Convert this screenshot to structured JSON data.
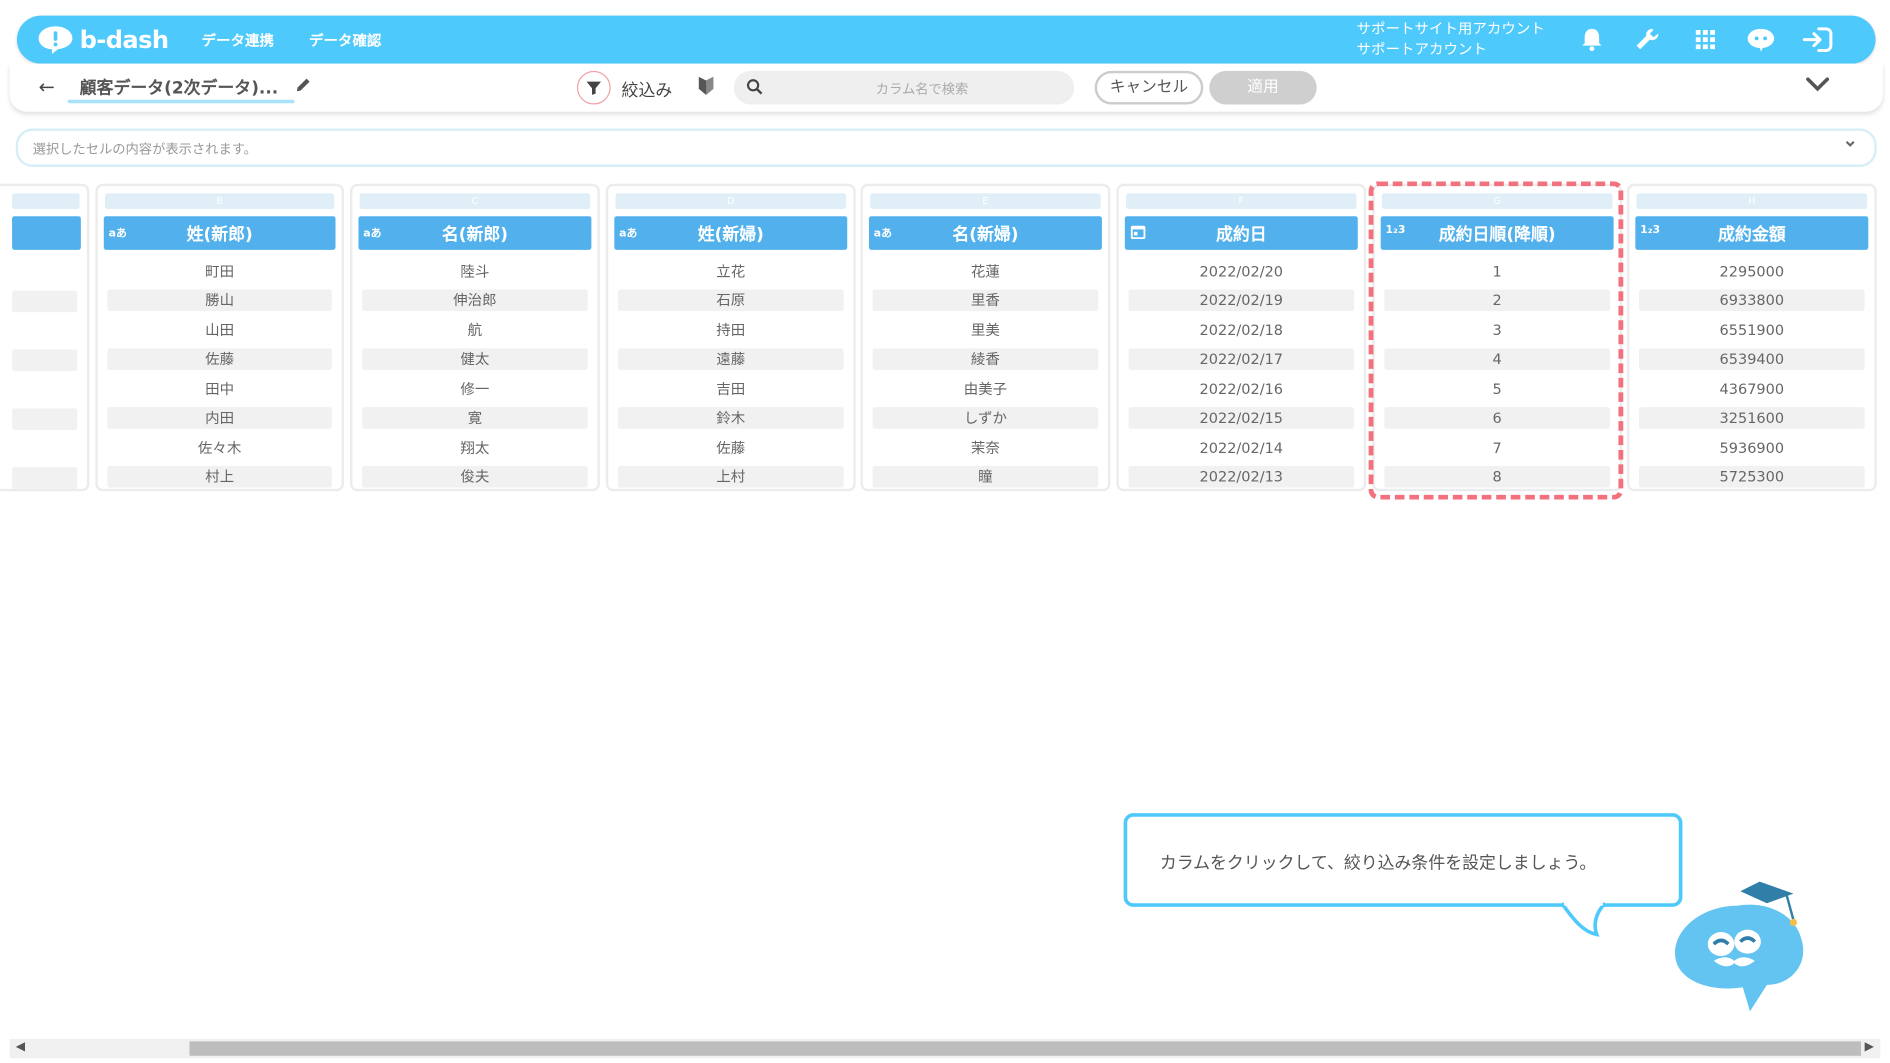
{
  "app": {
    "logo_text": "b-dash"
  },
  "nav": {
    "item1": "データ連携",
    "item2": "データ確認"
  },
  "account": {
    "line1": "サポートサイト用アカウント",
    "line2": "サポートアカウント"
  },
  "toolbar": {
    "breadcrumb": "顧客データ(2次データ)...",
    "filter_label": "絞込み",
    "search_placeholder": "カラム名で検索",
    "cancel_label": "キャンセル",
    "apply_label": "適用"
  },
  "cell_display": {
    "placeholder": "選択したセルの内容が表示されます。"
  },
  "columns": [
    {
      "letter": "B",
      "type": "aあ",
      "name": "姓(新郎)",
      "values": [
        "町田",
        "勝山",
        "山田",
        "佐藤",
        "田中",
        "内田",
        "佐々木",
        "村上"
      ]
    },
    {
      "letter": "C",
      "type": "aあ",
      "name": "名(新郎)",
      "values": [
        "陸斗",
        "伸治郎",
        "航",
        "健太",
        "修一",
        "寛",
        "翔太",
        "俊夫"
      ]
    },
    {
      "letter": "D",
      "type": "aあ",
      "name": "姓(新婦)",
      "values": [
        "立花",
        "石原",
        "持田",
        "遠藤",
        "吉田",
        "鈴木",
        "佐藤",
        "上村"
      ]
    },
    {
      "letter": "E",
      "type": "aあ",
      "name": "名(新婦)",
      "values": [
        "花蓮",
        "里香",
        "里美",
        "綾香",
        "由美子",
        "しずか",
        "茉奈",
        "瞳"
      ]
    },
    {
      "letter": "F",
      "type": "",
      "name": "成約日",
      "values": [
        "2022/02/20",
        "2022/02/19",
        "2022/02/18",
        "2022/02/17",
        "2022/02/16",
        "2022/02/15",
        "2022/02/14",
        "2022/02/13"
      ]
    },
    {
      "letter": "G",
      "type": "1₂3",
      "name": "成約日順(降順)",
      "values": [
        "1",
        "2",
        "3",
        "4",
        "5",
        "6",
        "7",
        "8"
      ]
    },
    {
      "letter": "H",
      "type": "1₂3",
      "name": "成約金額",
      "values": [
        "2295000",
        "6933800",
        "6551900",
        "6539400",
        "4367900",
        "3251600",
        "5936900",
        "5725300"
      ]
    }
  ],
  "tooltip": {
    "text": "カラムをクリックして、絞り込み条件を設定しましょう。"
  },
  "colors": {
    "brand": "#4ec9fb",
    "header": "#52b1ec",
    "highlight": "#f3707d"
  }
}
